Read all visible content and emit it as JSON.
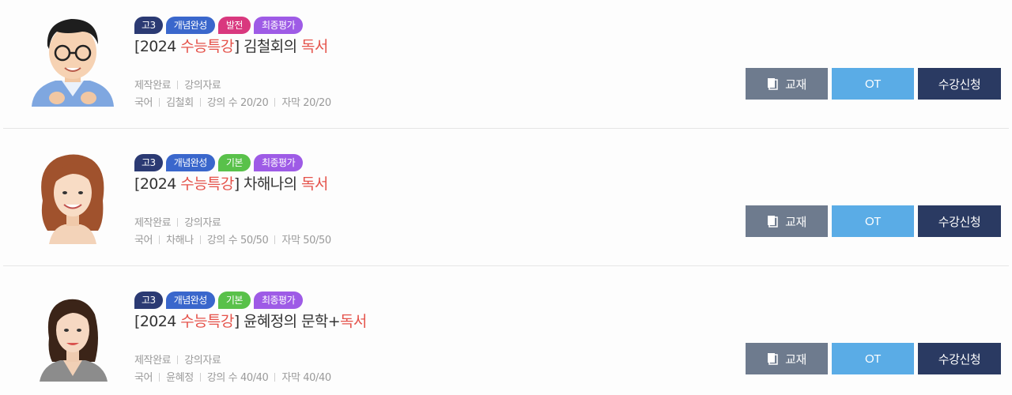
{
  "courses": [
    {
      "tags": [
        {
          "label": "고3",
          "kind": "grade"
        },
        {
          "label": "개념완성",
          "kind": "concept"
        },
        {
          "label": "발전",
          "kind": "advanced"
        },
        {
          "label": "최종평가",
          "kind": "final"
        }
      ],
      "title": {
        "prefix": "[2024 ",
        "series": "수능특강",
        "middle": "] 김철회의 ",
        "subject": "독서"
      },
      "status": "제작완료",
      "materials": "강의자료",
      "subject_area": "국어",
      "teacher": "김철회",
      "lecture_count": "강의 수 20/20",
      "subtitles": "자막 20/20",
      "buttons": {
        "book": "교재",
        "ot": "OT",
        "enroll": "수강신청"
      }
    },
    {
      "tags": [
        {
          "label": "고3",
          "kind": "grade"
        },
        {
          "label": "개념완성",
          "kind": "concept"
        },
        {
          "label": "기본",
          "kind": "basic"
        },
        {
          "label": "최종평가",
          "kind": "final"
        }
      ],
      "title": {
        "prefix": "[2024 ",
        "series": "수능특강",
        "middle": "] 차해나의 ",
        "subject": "독서"
      },
      "status": "제작완료",
      "materials": "강의자료",
      "subject_area": "국어",
      "teacher": "차해나",
      "lecture_count": "강의 수 50/50",
      "subtitles": "자막 50/50",
      "buttons": {
        "book": "교재",
        "ot": "OT",
        "enroll": "수강신청"
      }
    },
    {
      "tags": [
        {
          "label": "고3",
          "kind": "grade"
        },
        {
          "label": "개념완성",
          "kind": "concept"
        },
        {
          "label": "기본",
          "kind": "basic"
        },
        {
          "label": "최종평가",
          "kind": "final"
        }
      ],
      "title": {
        "prefix": "[2024 ",
        "series": "수능특강",
        "middle": "] 윤혜정의 문학+",
        "subject": "독서"
      },
      "status": "제작완료",
      "materials": "강의자료",
      "subject_area": "국어",
      "teacher": "윤혜정",
      "lecture_count": "강의 수 40/40",
      "subtitles": "자막 40/40",
      "buttons": {
        "book": "교재",
        "ot": "OT",
        "enroll": "수강신청"
      }
    }
  ],
  "colors": {
    "accent_red": "#e5534b",
    "grade_tag": "#2b3a73",
    "concept_tag": "#3a67cc",
    "advanced_tag": "#d9387e",
    "basic_tag": "#59c14a",
    "final_tag": "#9e5be6",
    "book_button": "#6e7b8e",
    "ot_button": "#5aace6",
    "enroll_button": "#2a3a62"
  },
  "icons": {
    "book_button_icon": "book-icon"
  }
}
